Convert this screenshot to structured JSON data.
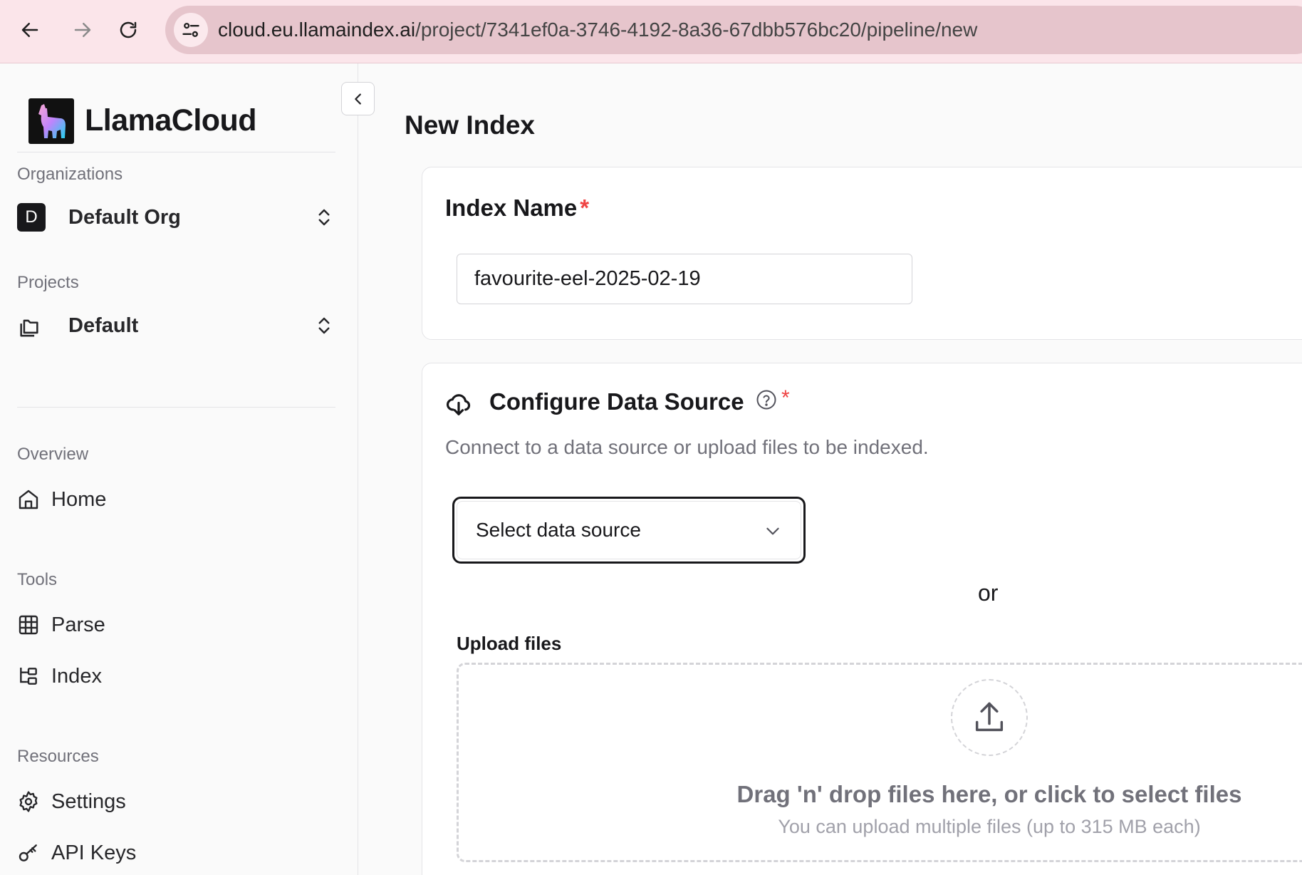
{
  "browser": {
    "url_host": "cloud.eu.llamaindex.ai",
    "url_path": "/project/7341ef0a-3746-4192-8a36-67dbb576bc20/pipeline/new"
  },
  "sidebar": {
    "brand": "LlamaCloud",
    "organizations_label": "Organizations",
    "org_initial": "D",
    "org_name": "Default Org",
    "projects_label": "Projects",
    "project_name": "Default",
    "sections": [
      {
        "label": "Overview",
        "items": [
          {
            "label": "Home",
            "icon": "home-icon"
          }
        ]
      },
      {
        "label": "Tools",
        "items": [
          {
            "label": "Parse",
            "icon": "grid-icon"
          },
          {
            "label": "Index",
            "icon": "tree-icon"
          }
        ]
      },
      {
        "label": "Resources",
        "items": [
          {
            "label": "Settings",
            "icon": "gear-icon"
          },
          {
            "label": "API Keys",
            "icon": "key-icon"
          }
        ]
      }
    ]
  },
  "main": {
    "title": "New Index",
    "index_name": {
      "label": "Index Name",
      "required_mark": "*",
      "value": "favourite-eel-2025-02-19"
    },
    "data_source": {
      "title": "Configure Data Source",
      "required_mark": "*",
      "description": "Connect to a data source or upload files to be indexed.",
      "select_placeholder": "Select data source",
      "or_text": "or",
      "upload_label": "Upload files",
      "drop_title": "Drag 'n' drop files here, or click to select files",
      "drop_subtitle": "You can upload multiple files (up to 315 MB each)"
    }
  },
  "colors": {
    "chrome_bg": "#fbe5ea",
    "address_bar": "#e6c5cc",
    "required": "#ef4444",
    "text": "#18181b",
    "muted": "#71717a"
  }
}
